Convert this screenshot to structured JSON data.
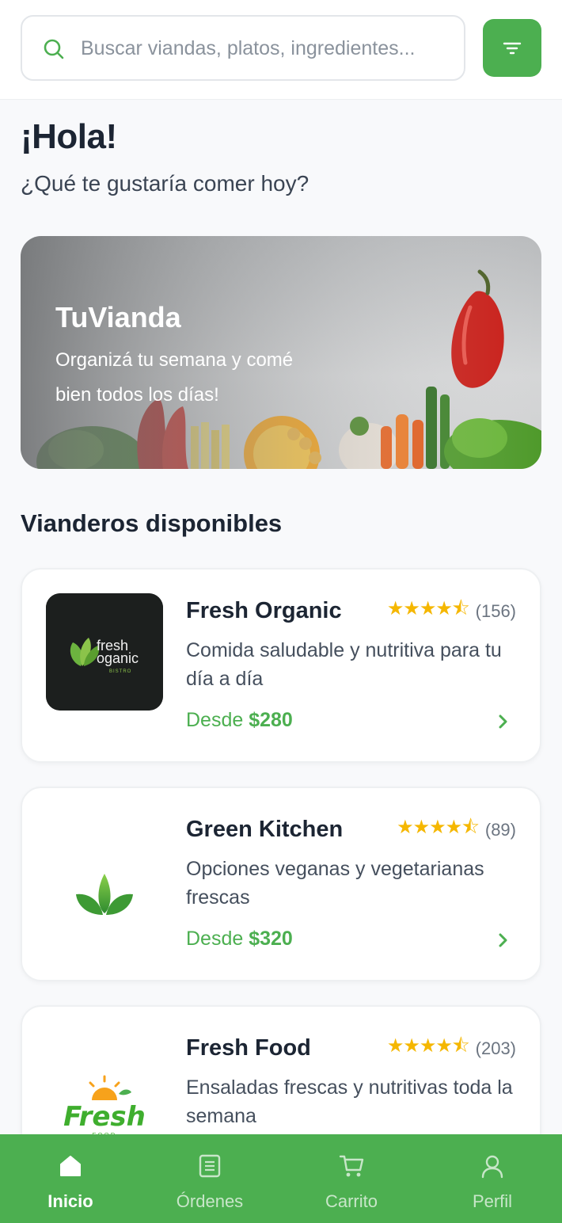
{
  "search": {
    "placeholder": "Buscar viandas, platos, ingredientes..."
  },
  "greeting": {
    "title": "¡Hola!",
    "subtitle": "¿Qué te gustaría comer hoy?"
  },
  "hero": {
    "title": "TuVianda",
    "text": "Organizá tu semana y comé bien todos los días!"
  },
  "section_title": "Vianderos disponibles",
  "vendors": [
    {
      "name": "Fresh Organic",
      "rating": 4.5,
      "stars": "★★★★⯪",
      "count": "(156)",
      "description": "Comida saludable y nutritiva para tu día a día",
      "price_prefix": "Desde",
      "price": "$280",
      "logo": {
        "line1": "fresh",
        "line2": "oganic",
        "line3": "BISTRO"
      }
    },
    {
      "name": "Green Kitchen",
      "rating": 4.5,
      "stars": "★★★★⯪",
      "count": "(89)",
      "description": "Opciones veganas y vegetarianas frescas",
      "price_prefix": "Desde",
      "price": "$320"
    },
    {
      "name": "Fresh Food",
      "rating": 4.5,
      "stars": "★★★★⯪",
      "count": "(203)",
      "description": "Ensaladas frescas y nutritivas toda la semana",
      "logo": {
        "line1": "Fresh",
        "line2": "FOOD"
      }
    }
  ],
  "nav": [
    {
      "label": "Inicio",
      "icon": "home-icon",
      "active": true
    },
    {
      "label": "Órdenes",
      "icon": "orders-icon",
      "active": false
    },
    {
      "label": "Carrito",
      "icon": "cart-icon",
      "active": false
    },
    {
      "label": "Perfil",
      "icon": "profile-icon",
      "active": false
    }
  ],
  "colors": {
    "accent": "#4caf50",
    "star": "#f5b700",
    "text": "#1c2533"
  }
}
